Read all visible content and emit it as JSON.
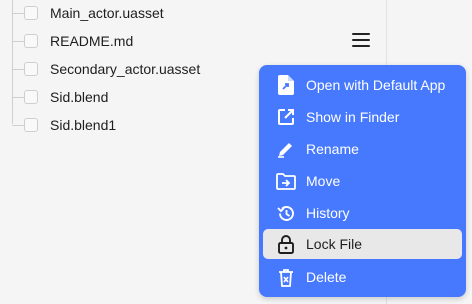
{
  "files": [
    {
      "name": "Main_actor.uasset"
    },
    {
      "name": "README.md"
    },
    {
      "name": "Secondary_actor.uasset"
    },
    {
      "name": "Sid.blend"
    },
    {
      "name": "Sid.blend1"
    }
  ],
  "context_menu": {
    "items": [
      {
        "label": "Open with Default App",
        "icon": "open-file-icon"
      },
      {
        "label": "Show in Finder",
        "icon": "external-link-icon"
      },
      {
        "label": "Rename",
        "icon": "pencil-icon"
      },
      {
        "label": "Move",
        "icon": "move-folder-icon"
      },
      {
        "label": "History",
        "icon": "history-icon"
      },
      {
        "label": "Lock File",
        "icon": "lock-icon",
        "highlighted": true
      },
      {
        "label": "Delete",
        "icon": "trash-icon"
      }
    ]
  },
  "colors": {
    "menu_background": "#4779ff",
    "menu_highlight": "#e8e8e8",
    "page_background": "#f5f5f5"
  }
}
